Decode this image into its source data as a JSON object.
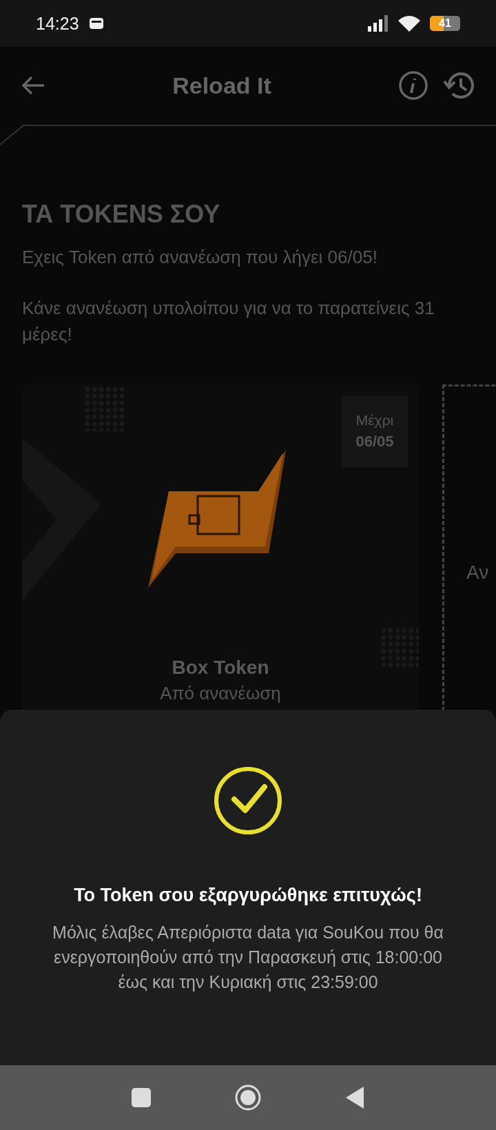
{
  "status_bar": {
    "time": "14:23",
    "battery": "41"
  },
  "header": {
    "title": "Reload It"
  },
  "tokens_section": {
    "heading": "ΤΑ TOKENS ΣΟΥ",
    "messages": [
      "Εχεις Token από ανανέωση που λήγει 06/05!",
      "Κάνε ανανέωση υπολοίπου για να το παρατείνεις 31 μέρες!"
    ]
  },
  "tokens": [
    {
      "kind": "token",
      "until_label": "Μέχρι",
      "until_date": "06/05",
      "name": "Box Token",
      "source": "Από ανανέωση"
    },
    {
      "kind": "empty",
      "text": "Αν"
    }
  ],
  "dialog": {
    "title": "Το Token σου εξαργυρώθηκε επιτυχώς!",
    "message": "Μόλις έλαβες Απεριόριστα data για SouKou που θα ενεργοποιηθούν από την Παρασκευή στις 18:00:00 έως και την Κυριακή στις 23:59:00"
  }
}
